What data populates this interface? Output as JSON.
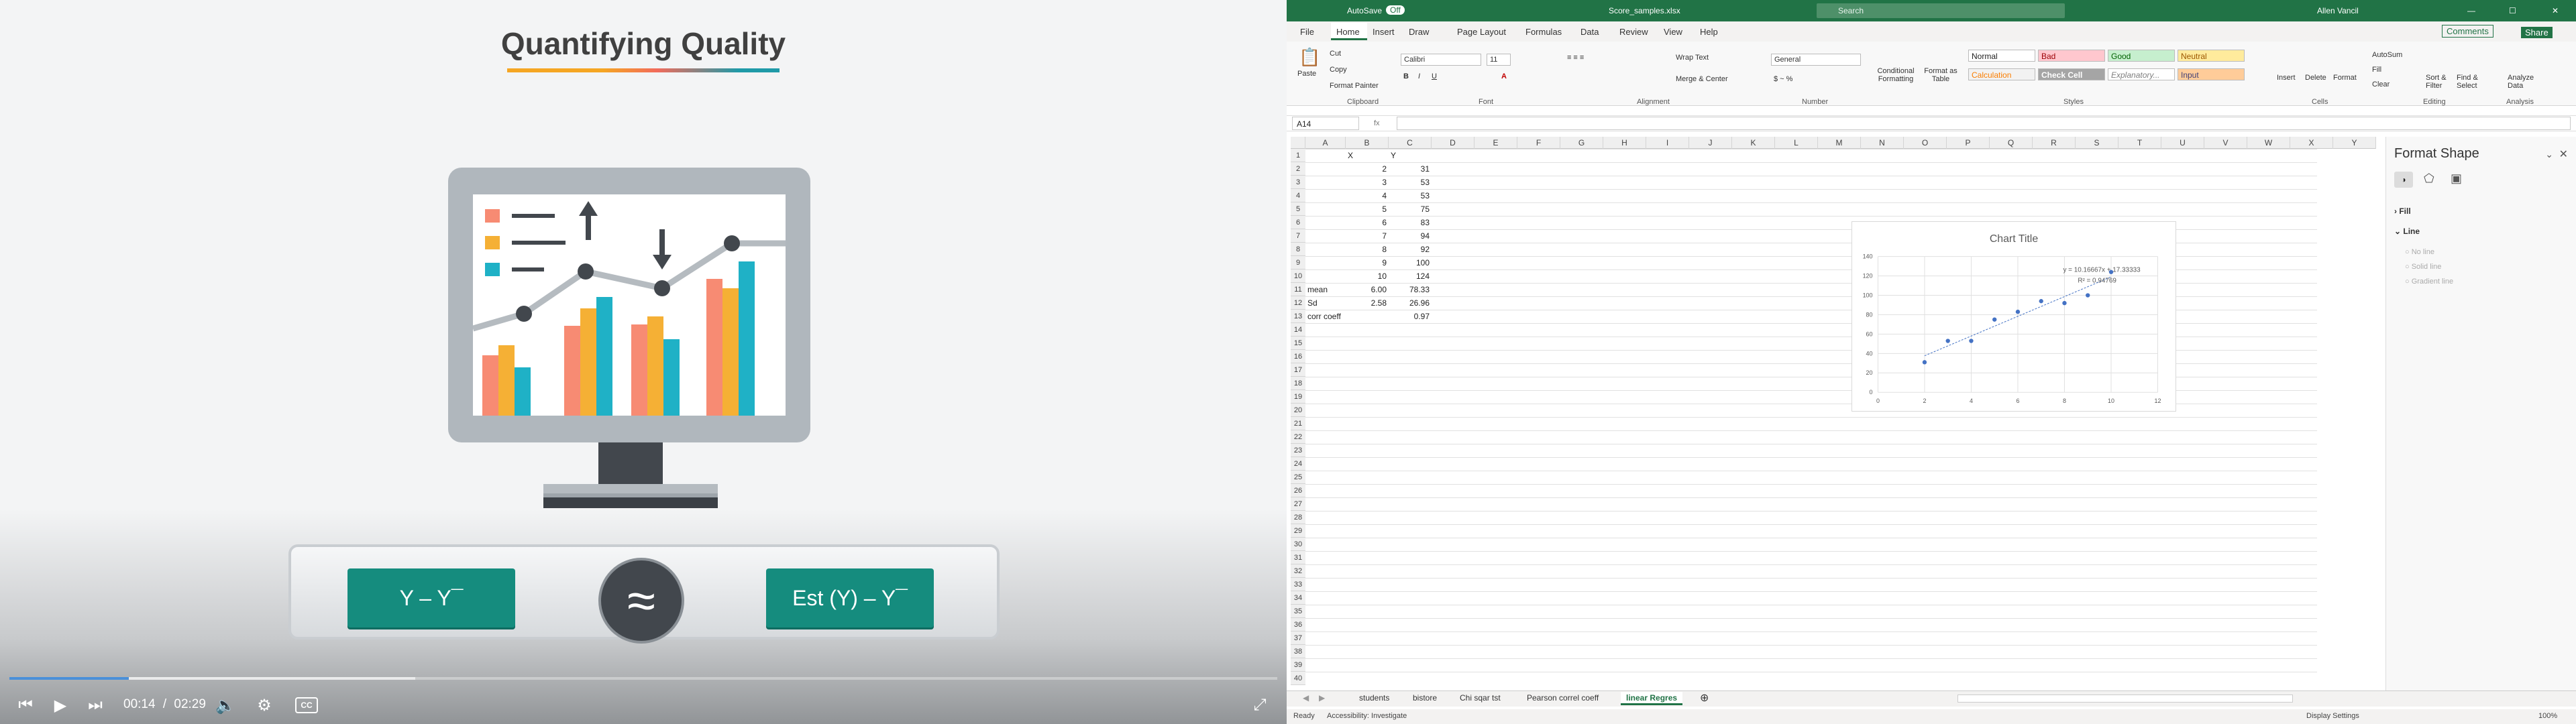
{
  "video": {
    "title": "Quantifying Quality",
    "formula_left": "Y – Y¯",
    "formula_right": "Est (Y) – Y¯",
    "approx_symbol": "≈",
    "current_time": "00:14",
    "time_separator": "/",
    "duration": "02:29",
    "played_fraction": 0.094,
    "buffered_fraction": 0.32,
    "cc_label": "CC",
    "icons": [
      "skip-back-icon",
      "play-icon",
      "skip-forward-icon",
      "volume-icon",
      "settings-icon",
      "cc-icon",
      "fullscreen-icon"
    ]
  },
  "excel": {
    "titlebar": {
      "autosave": "AutoSave",
      "autosave_state": "Off",
      "filename": "Score_samples.xlsx",
      "search_placeholder": "Search",
      "user": "Allen Vancil"
    },
    "menu": [
      "File",
      "Home",
      "Insert",
      "Draw",
      "Page Layout",
      "Formulas",
      "Data",
      "Review",
      "View",
      "Help"
    ],
    "menu_right": {
      "comments": "Comments",
      "share": "Share"
    },
    "ribbon": {
      "clipboard": {
        "paste": "Paste",
        "cut": "Cut",
        "copy": "Copy",
        "format_painter": "Format Painter",
        "group": "Clipboard"
      },
      "font": {
        "name": "Calibri",
        "size": "11",
        "group": "Font"
      },
      "alignment": {
        "wrap": "Wrap Text",
        "merge": "Merge & Center",
        "group": "Alignment"
      },
      "number": {
        "format": "General",
        "group": "Number"
      },
      "styles": {
        "conditional": "Conditional Formatting",
        "format_as_table": "Format as Table",
        "normal": "Normal",
        "bad": "Bad",
        "good": "Good",
        "neutral": "Neutral",
        "calculation": "Calculation",
        "check_cell": "Check Cell",
        "explanatory": "Explanatory...",
        "input": "Input",
        "group": "Styles"
      },
      "cells": {
        "insert": "Insert",
        "delete": "Delete",
        "format": "Format",
        "group": "Cells"
      },
      "editing": {
        "autosum": "AutoSum",
        "fill": "Fill",
        "clear": "Clear",
        "sort": "Sort & Filter",
        "find": "Find & Select",
        "group": "Editing"
      },
      "analysis": {
        "analyze": "Analyze Data",
        "group": "Analysis"
      }
    },
    "namebox": "A14",
    "columns": [
      "A",
      "B",
      "C",
      "D",
      "E",
      "F",
      "G",
      "H",
      "I",
      "J",
      "K",
      "L",
      "M",
      "N",
      "O",
      "P",
      "Q",
      "R",
      "S",
      "T",
      "U",
      "V",
      "W",
      "X",
      "Y"
    ],
    "rows": {
      "r1": {
        "B": "X",
        "C": "Y"
      },
      "data": [
        {
          "row": 2,
          "x": "2",
          "y": "31"
        },
        {
          "row": 3,
          "x": "3",
          "y": "53"
        },
        {
          "row": 4,
          "x": "4",
          "y": "53"
        },
        {
          "row": 5,
          "x": "5",
          "y": "75"
        },
        {
          "row": 6,
          "x": "6",
          "y": "83"
        },
        {
          "row": 7,
          "x": "7",
          "y": "94"
        },
        {
          "row": 8,
          "x": "8",
          "y": "92"
        },
        {
          "row": 9,
          "x": "9",
          "y": "100"
        },
        {
          "row": 10,
          "x": "10",
          "y": "124"
        }
      ],
      "mean": {
        "label": "mean",
        "x": "6.00",
        "y": "78.33"
      },
      "sd": {
        "label": "Sd",
        "x": "2.58",
        "y": "26.96"
      },
      "corr": {
        "label": "corr coeff",
        "y": "0.97"
      }
    },
    "sheet_tabs": [
      "students",
      "bistore",
      "Chi sqar tst",
      "Pearson correl coeff",
      "linear Regres"
    ],
    "active_tab": "linear Regres",
    "status": {
      "ready": "Ready",
      "accessibility": "Accessibility: Investigate",
      "display": "Display Settings",
      "zoom": "100%"
    },
    "format_pane": {
      "title": "Format Shape",
      "fill": "Fill",
      "line": "Line",
      "no_line": "No line",
      "solid_line": "Solid line",
      "gradient_line": "Gradient line"
    }
  },
  "chart_data": {
    "type": "scatter",
    "title": "Chart Title",
    "x": [
      2,
      3,
      4,
      5,
      6,
      7,
      8,
      9,
      10
    ],
    "y": [
      31,
      53,
      53,
      75,
      83,
      94,
      92,
      100,
      124
    ],
    "trendline": {
      "type": "linear",
      "equation": "y = 10.16667x + 17.33333",
      "r2": "R² = 0.94769",
      "slope": 10.16667,
      "intercept": 17.33333
    },
    "xlim": [
      0,
      12
    ],
    "ylim": [
      0,
      140
    ],
    "xticks": [
      "0",
      "2",
      "4",
      "6",
      "8",
      "10",
      "12"
    ],
    "yticks": [
      "0",
      "20",
      "40",
      "60",
      "80",
      "100",
      "120",
      "140"
    ],
    "grid": true,
    "color": "#4472c4"
  }
}
